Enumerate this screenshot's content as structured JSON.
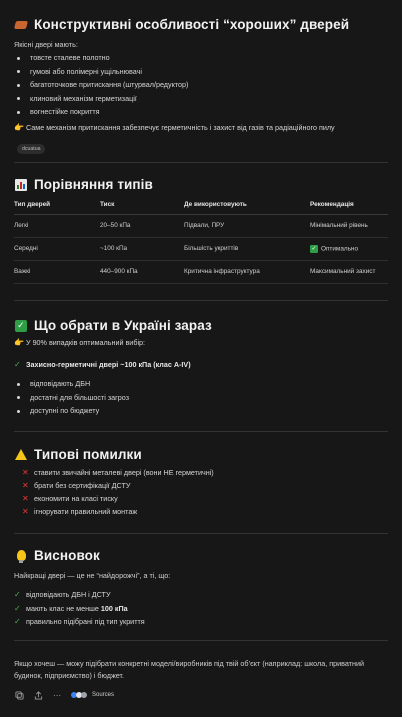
{
  "construct": {
    "title": "Конструктивні особливості “хороших” дверей",
    "intro": "Якісні двері мають:",
    "items": [
      "товсте сталеве полотно",
      "гумові або полімерні ущільнювачі",
      "багатоточкове притискання (штурвал/редуктор)",
      "клиновий механізм герметизації",
      "вогнестійке покриття"
    ],
    "note": "Саме механізм притискання забезпечує герметичність і захист від газів та радіаційного пилу",
    "tag": "dcuatua"
  },
  "compare": {
    "title": "Порівняння типів",
    "headers": [
      "Тип дверей",
      "Тиск",
      "Де використовують",
      "Рекомендація"
    ],
    "rows": [
      [
        "Легкі",
        "20–50 кПа",
        "Підвали, ПРУ",
        "Мінімальний рівень"
      ],
      [
        "Середні",
        "~100 кПа",
        "Більшість укриттів",
        "Оптимально"
      ],
      [
        "Важкі",
        "440–900 кПа",
        "Критична інфраструктура",
        "Максимальний захист"
      ]
    ]
  },
  "choose": {
    "title": "Що обрати в Україні зараз",
    "pointer": "У 90% випадків оптимальний вибір:",
    "checked": "Захисно-герметичні двері ~100 кПа (клас А-IV)",
    "items": [
      "відповідають ДБН",
      "достатні для більшості загроз",
      "доступні по бюджету"
    ]
  },
  "mistakes": {
    "title": "Типові помилки",
    "items": [
      "ставити звичайні металеві двері (вони НЕ герметичні)",
      "брати без сертифікації ДСТУ",
      "економити на класі тиску",
      "ігнорувати правильний монтаж"
    ]
  },
  "conclusion": {
    "title": "Висновок",
    "intro": "Найкращі двері — це не “найдорожчі”, а ті, що:",
    "items": {
      "a": "відповідають ДБН і ДСТУ",
      "b_pre": "мають клас не менше ",
      "b_bold": "100 кПа",
      "c": "правильно підібрані під тип укриття"
    }
  },
  "followup": "Якщо хочеш — можу підібрати конкретні моделі/виробників під твій об’єкт (наприклад: школа, приватний будинок, підприємство) і бюджет.",
  "footer": {
    "sources_label": "Sources"
  },
  "colors": {
    "background": "#171717",
    "check": "#4caf50",
    "cross": "#e53935",
    "accent_green": "#2e9e46"
  }
}
